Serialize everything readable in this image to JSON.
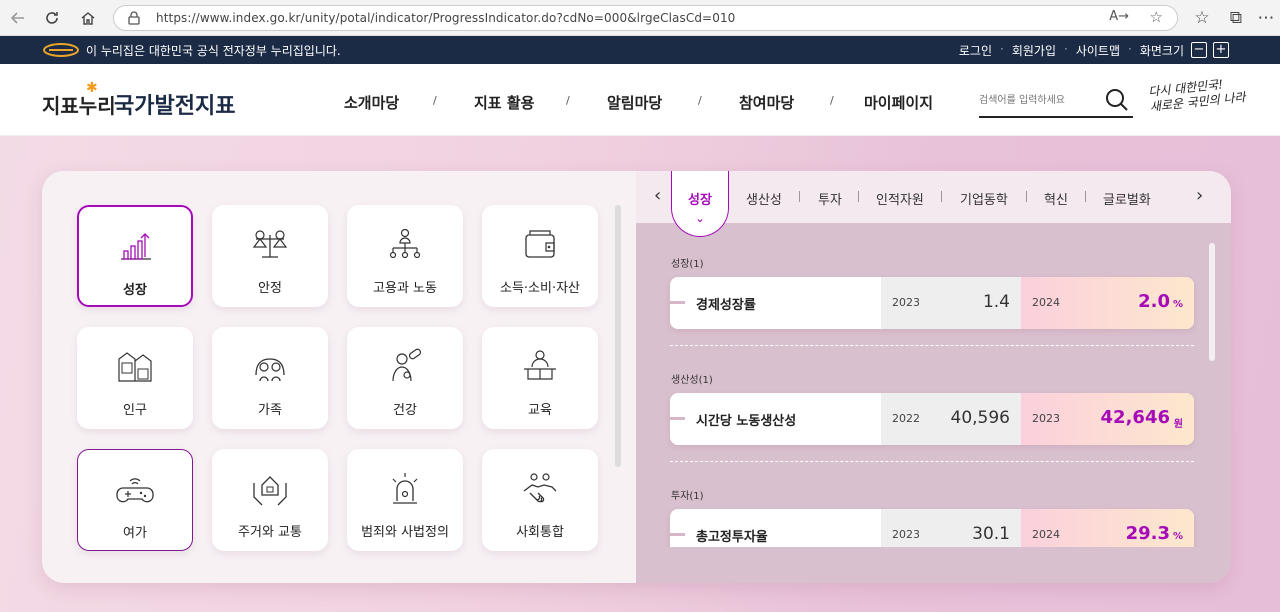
{
  "browser": {
    "url": "https://www.index.go.kr/unity/potal/indicator/ProgressIndicator.do?cdNo=000&lrgeClasCd=010",
    "back_icon": "arrow-left-icon",
    "reload_icon": "reload-icon",
    "home_icon": "home-icon",
    "read_aloud": "A→",
    "favorite_icon": "star-icon"
  },
  "gov_bar": {
    "text": "이 누리집은 대한민국 공식 전자정부 누리집입니다.",
    "links": [
      "로그인",
      "회원가입",
      "사이트맵",
      "화면크기"
    ],
    "zoom_out": "−",
    "zoom_in": "+"
  },
  "header": {
    "brand_left": "지표누리",
    "brand_main": "국가발전지표",
    "nav": [
      "소개마당",
      "지표 활용",
      "알림마당",
      "참여마당",
      "마이페이지"
    ],
    "nav_sep": "/",
    "search_placeholder": "검색어를 입력하세요",
    "slogan_line1": "다시 대한민국!",
    "slogan_line2": "새로운 국민의 나라"
  },
  "categories": [
    {
      "label": "성장",
      "icon": "growth-chart-icon",
      "active": true
    },
    {
      "label": "안정",
      "icon": "scale-coins-icon"
    },
    {
      "label": "고용과 노동",
      "icon": "org-people-icon"
    },
    {
      "label": "소득·소비·자산",
      "icon": "wallet-icon"
    },
    {
      "label": "인구",
      "icon": "population-icon"
    },
    {
      "label": "가족",
      "icon": "family-icon"
    },
    {
      "label": "건강",
      "icon": "health-icon"
    },
    {
      "label": "교육",
      "icon": "education-icon"
    },
    {
      "label": "여가",
      "icon": "gamepad-icon",
      "highlighted": true
    },
    {
      "label": "주거와 교통",
      "icon": "house-hands-icon"
    },
    {
      "label": "범죄와 사법정의",
      "icon": "siren-icon"
    },
    {
      "label": "사회통합",
      "icon": "handshake-icon"
    }
  ],
  "tabs": [
    "성장",
    "생산성",
    "투자",
    "인적자원",
    "기업동학",
    "혁신",
    "글로벌화"
  ],
  "indicators": [
    {
      "section": "성장(1)",
      "name": "경제성장률",
      "prev_year": "2023",
      "prev_value": "1.4",
      "cur_year": "2024",
      "cur_value": "2.0",
      "unit": "%"
    },
    {
      "section": "생산성(1)",
      "name": "시간당 노동생산성",
      "prev_year": "2022",
      "prev_value": "40,596",
      "cur_year": "2023",
      "cur_value": "42,646",
      "unit": "원"
    },
    {
      "section": "투자(1)",
      "name": "총고정투자율",
      "prev_year": "2023",
      "prev_value": "30.1",
      "cur_year": "2024",
      "cur_value": "29.3",
      "unit": "%"
    }
  ],
  "colors": {
    "accent": "#a60bb8",
    "navy": "#1c2b45",
    "orange": "#f29b1b"
  }
}
